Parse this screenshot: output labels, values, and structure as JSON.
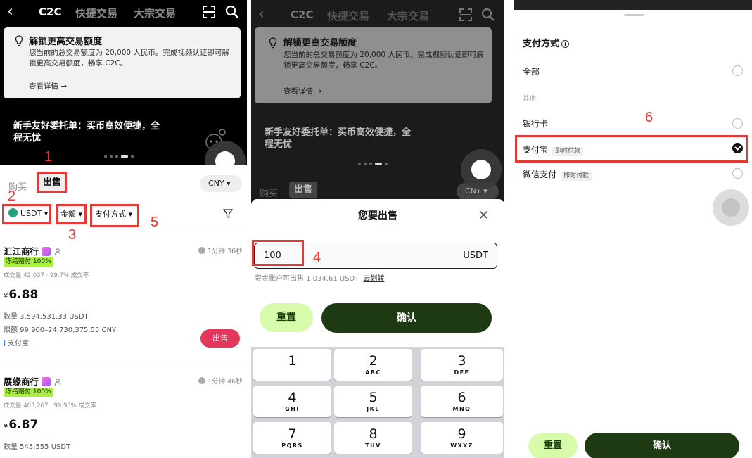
{
  "nav": {
    "tabs": [
      "C2C",
      "快捷交易",
      "大宗交易"
    ]
  },
  "notice": {
    "title": "解锁更高交易额度",
    "text": "您当前的总交易额度为 20,000 人民币。完成视频认证即可解锁更高交易额度，畅享 C2C。",
    "more": "查看详情 →"
  },
  "promo": {
    "text": "新手友好委托单：买币高效便捷，全程无忧"
  },
  "market": {
    "buy_tab": "购买",
    "sell_tab": "出售",
    "currency": "CNY ▾",
    "filters": {
      "coin": "USDT ▾",
      "amount": "金额 ▾",
      "payment": "支付方式 ▾"
    },
    "merchants": [
      {
        "name": "汇江商行",
        "time": "1分钟 36秒",
        "tag": "冻结赔付 100%",
        "stats": "成交量 42,037 · 99.7% 成交率",
        "currency_sign": "¥",
        "price": "6.88",
        "quantity": "数量 3,594,531.33 USDT",
        "limit": "限额 99,900–24,730,375.55 CNY",
        "payment": "支付宝",
        "action": "出售"
      },
      {
        "name": "展缘商行",
        "time": "1分钟 46秒",
        "tag": "冻结赔付 100%",
        "stats": "成交量 403,267 · 99.98% 成交率",
        "currency_sign": "¥",
        "price": "6.87",
        "quantity": "数量 545,555 USDT"
      }
    ]
  },
  "sell_sheet": {
    "title": "您要出售",
    "close": "✕",
    "amount_value": "100",
    "amount_unit": "USDT",
    "available": "资金账户可出售 1,034.61 USDT",
    "transfer": "去划转",
    "reset": "重置",
    "confirm": "确认"
  },
  "keypad": [
    {
      "digit": "1",
      "letters": ""
    },
    {
      "digit": "2",
      "letters": "ABC"
    },
    {
      "digit": "3",
      "letters": "DEF"
    },
    {
      "digit": "4",
      "letters": "GHI"
    },
    {
      "digit": "5",
      "letters": "JKL"
    },
    {
      "digit": "6",
      "letters": "MNO"
    },
    {
      "digit": "7",
      "letters": "PQRS"
    },
    {
      "digit": "8",
      "letters": "TUV"
    },
    {
      "digit": "9",
      "letters": "WXYZ"
    }
  ],
  "payment_sheet": {
    "title": "支付方式",
    "info": "i",
    "all": "全部",
    "group_other": "其他",
    "options": [
      {
        "label": "银行卡",
        "tag": "",
        "selected": false
      },
      {
        "label": "支付宝",
        "tag": "即时付款",
        "selected": true
      },
      {
        "label": "微信支付",
        "tag": "即时付款",
        "selected": false
      }
    ],
    "reset": "重置",
    "confirm": "确认"
  },
  "annotations": [
    "1",
    "2",
    "3",
    "4",
    "5",
    "6"
  ],
  "colors": {
    "accent_dark_green": "#1d3a12",
    "accent_light_green": "#d8fbab",
    "sell_red": "#e3385b",
    "annotation_red": "#e53935",
    "tag_lime": "#a8f23d"
  }
}
